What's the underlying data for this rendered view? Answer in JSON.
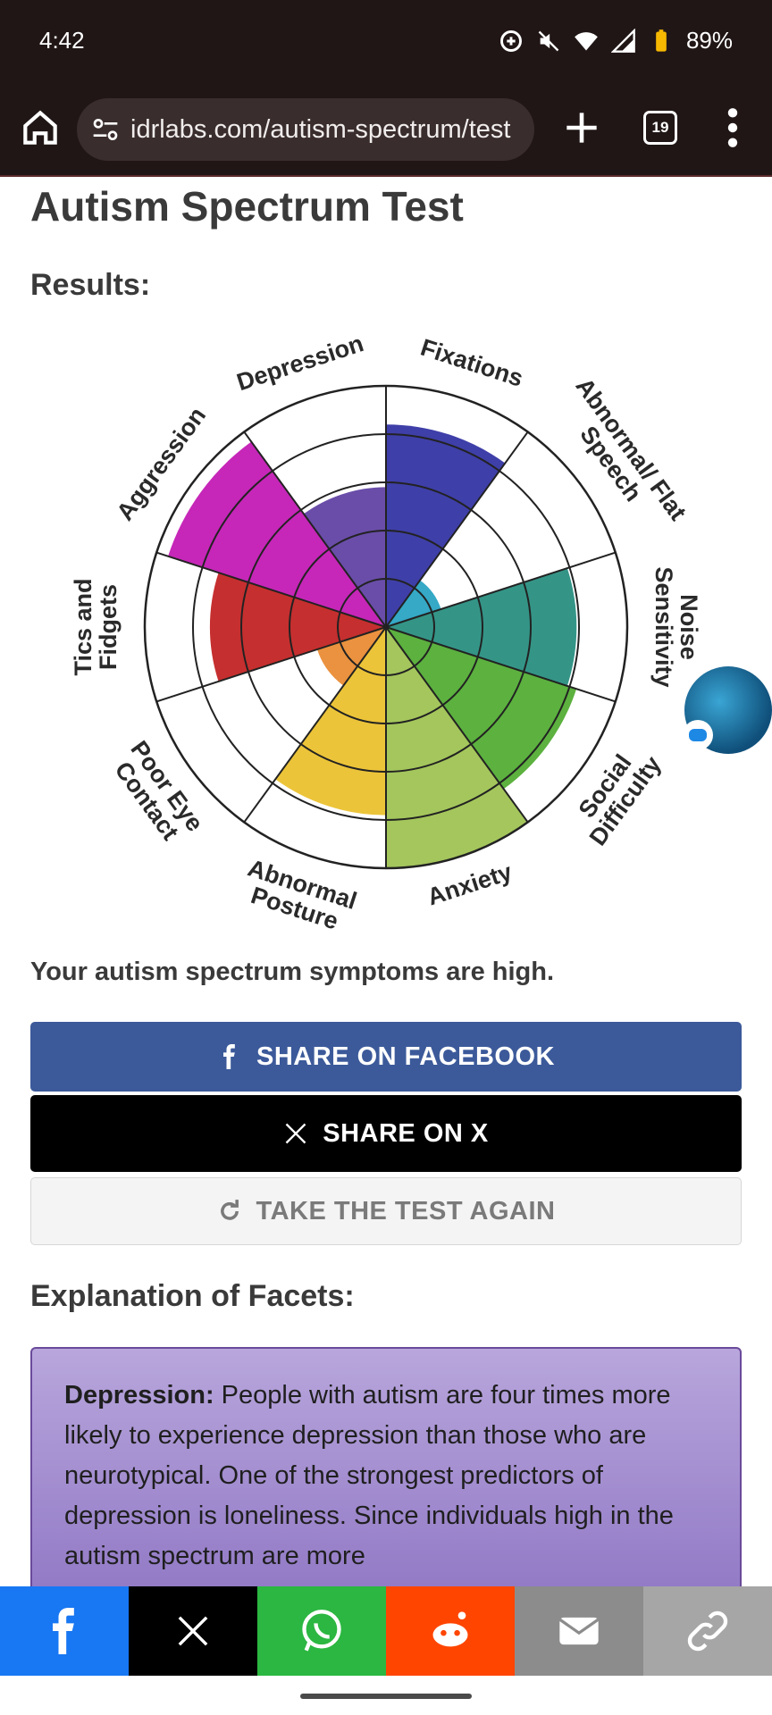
{
  "status": {
    "time": "4:42",
    "battery": "89%"
  },
  "browser": {
    "url": "idrlabs.com/autism-spectrum/test",
    "tab_count": "19"
  },
  "page": {
    "title": "Autism Spectrum Test",
    "results_heading": "Results:",
    "summary": "Your autism spectrum symptoms are high.",
    "explanation_heading": "Explanation of Facets:"
  },
  "chart_data": {
    "type": "polar-area",
    "title": "",
    "categories": [
      "Fixations",
      "Abnormal/ Flat Speech",
      "Noise Sensitivity",
      "Social Difficulty",
      "Anxiety",
      "Abnormal Posture",
      "Poor Eye Contact",
      "Tics and Fidgets",
      "Aggression",
      "Depression"
    ],
    "values": [
      0.84,
      0.24,
      0.79,
      0.83,
      1.0,
      0.78,
      0.3,
      0.73,
      0.95,
      0.58
    ],
    "colors": [
      "#2a2aa0",
      "#1fa0c0",
      "#1e8a7a",
      "#4aa82a",
      "#9ac04a",
      "#eabe24",
      "#e8862a",
      "#c01818",
      "#c010b0",
      "#5a3aa0"
    ],
    "ylim": [
      0,
      1
    ],
    "grid": true
  },
  "buttons": {
    "facebook": "SHARE ON FACEBOOK",
    "x": "SHARE ON X",
    "again": "TAKE THE TEST AGAIN"
  },
  "facet": {
    "term": "Depression:",
    "text": " People with autism are four times more likely to experience depression than those who are neurotypical. One of the strongest predictors of depression is loneliness. Since individuals high in the autism spectrum are more"
  },
  "share_bar": [
    {
      "icon": "facebook-icon",
      "color": "#1877f2"
    },
    {
      "icon": "x-icon",
      "color": "#000000"
    },
    {
      "icon": "whatsapp-icon",
      "color": "#2bb741"
    },
    {
      "icon": "reddit-icon",
      "color": "#ff4500"
    },
    {
      "icon": "email-icon",
      "color": "#8c8c8c"
    },
    {
      "icon": "link-icon",
      "color": "#a6a6a6"
    }
  ]
}
